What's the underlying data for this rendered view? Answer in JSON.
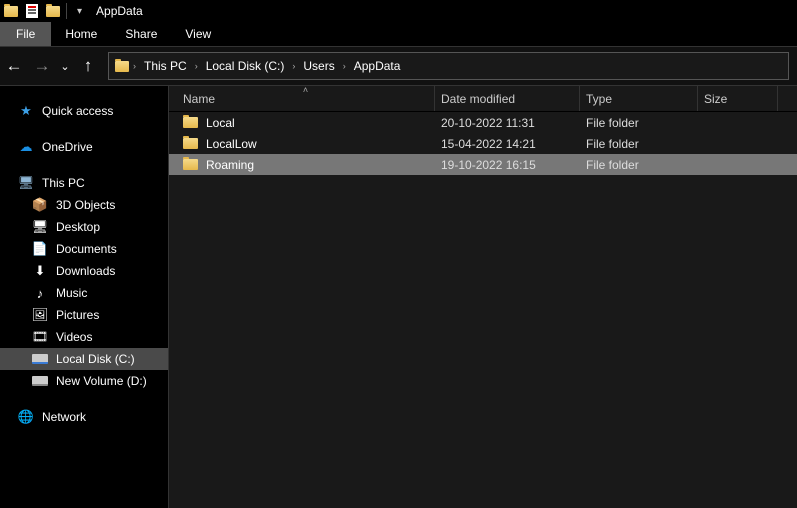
{
  "title": "AppData",
  "tabs": {
    "file": "File",
    "home": "Home",
    "share": "Share",
    "view": "View"
  },
  "breadcrumbs": [
    "This PC",
    "Local Disk (C:)",
    "Users",
    "AppData"
  ],
  "columns": {
    "name": "Name",
    "date": "Date modified",
    "type": "Type",
    "size": "Size"
  },
  "sidebar": {
    "quick_access": "Quick access",
    "onedrive": "OneDrive",
    "this_pc": "This PC",
    "objects3d": "3D Objects",
    "desktop": "Desktop",
    "documents": "Documents",
    "downloads": "Downloads",
    "music": "Music",
    "pictures": "Pictures",
    "videos": "Videos",
    "local_disk_c": "Local Disk (C:)",
    "new_volume_d": "New Volume (D:)",
    "network": "Network"
  },
  "rows": [
    {
      "name": "Local",
      "date": "20-10-2022 11:31",
      "type": "File folder",
      "selected": false
    },
    {
      "name": "LocalLow",
      "date": "15-04-2022 14:21",
      "type": "File folder",
      "selected": false
    },
    {
      "name": "Roaming",
      "date": "19-10-2022 16:15",
      "type": "File folder",
      "selected": true
    }
  ]
}
